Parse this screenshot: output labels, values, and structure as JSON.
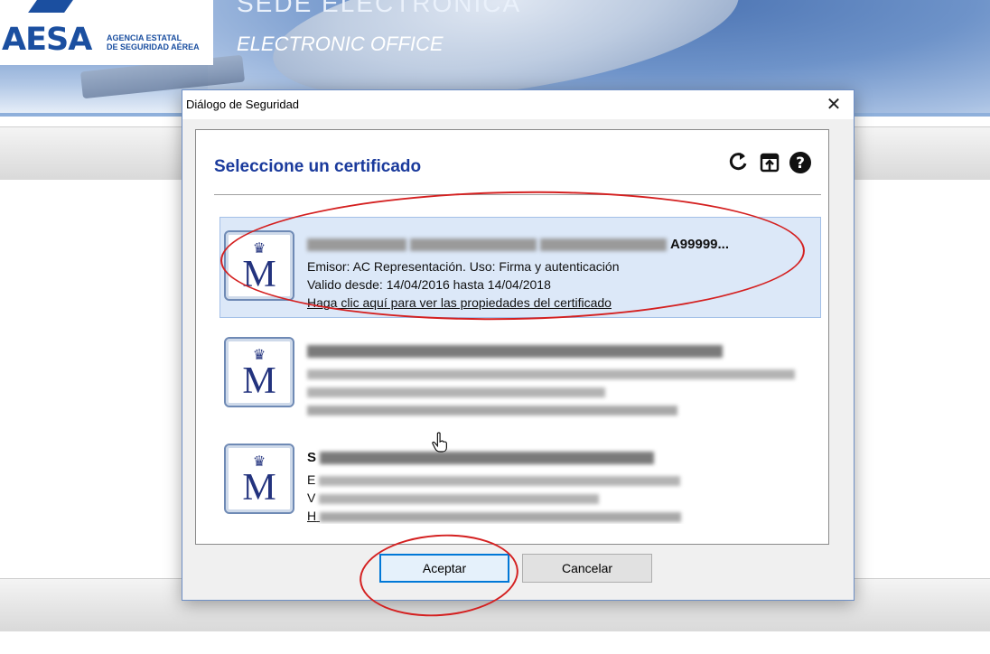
{
  "site": {
    "logo_text": "AESA",
    "agency_line1": "AGENCIA ESTATAL",
    "agency_line2": "DE SEGURIDAD AÉREA",
    "title_es": "SEDE ELECTRÓNICA",
    "title_en": "ELECTRONIC OFFICE"
  },
  "dialog": {
    "title": "Diálogo de Seguridad",
    "close_glyph": "✕",
    "heading": "Seleccione un certificado",
    "toolbar": [
      {
        "name": "refresh-icon",
        "glyph": "↻"
      },
      {
        "name": "open-file-icon",
        "glyph": "⇪"
      },
      {
        "name": "help-icon",
        "glyph": "?"
      }
    ],
    "certificates": [
      {
        "name_visible": "A99999...",
        "issuer_line": "Emisor: AC Representación. Uso: Firma y autenticación",
        "validity_line": "Valido desde: 14/04/2016 hasta 14/04/2018",
        "link": "Haga clic aquí para ver las propiedades del certificado",
        "selected": true
      },
      {
        "name_visible": "",
        "issuer_line": "",
        "validity_line": "",
        "link": "",
        "selected": false
      },
      {
        "name_visible": "S",
        "issuer_line": "E",
        "validity_line": "V",
        "link": "H",
        "selected": false
      }
    ],
    "buttons": {
      "accept": "Aceptar",
      "cancel": "Cancelar"
    }
  },
  "colors": {
    "heading": "#1a3a9c",
    "selected_bg": "#dce8f8",
    "annotation": "#d42020",
    "primary_border": "#0078d7"
  }
}
